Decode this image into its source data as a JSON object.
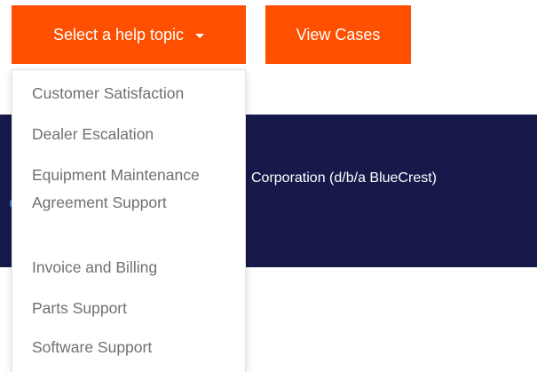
{
  "colors": {
    "accent": "#fe5000",
    "banner_bg": "#16194a",
    "banner_accent": "#e8402c",
    "banner_dot": "#2f7fd1"
  },
  "nav": {
    "topic_button": {
      "label": "Select a help topic",
      "icon": "caret-down-icon"
    },
    "view_cases_label": "View Cases"
  },
  "banner": {
    "text": "Corporation (d/b/a BlueCrest)"
  },
  "dropdown": {
    "items": [
      {
        "label": "Customer Satisfaction"
      },
      {
        "label": "Dealer Escalation"
      },
      {
        "label": "Equipment Maintenance Agreement Support"
      },
      {
        "label": "Invoice and Billing"
      },
      {
        "label": "Parts Support"
      },
      {
        "label": "Software Support"
      }
    ]
  }
}
